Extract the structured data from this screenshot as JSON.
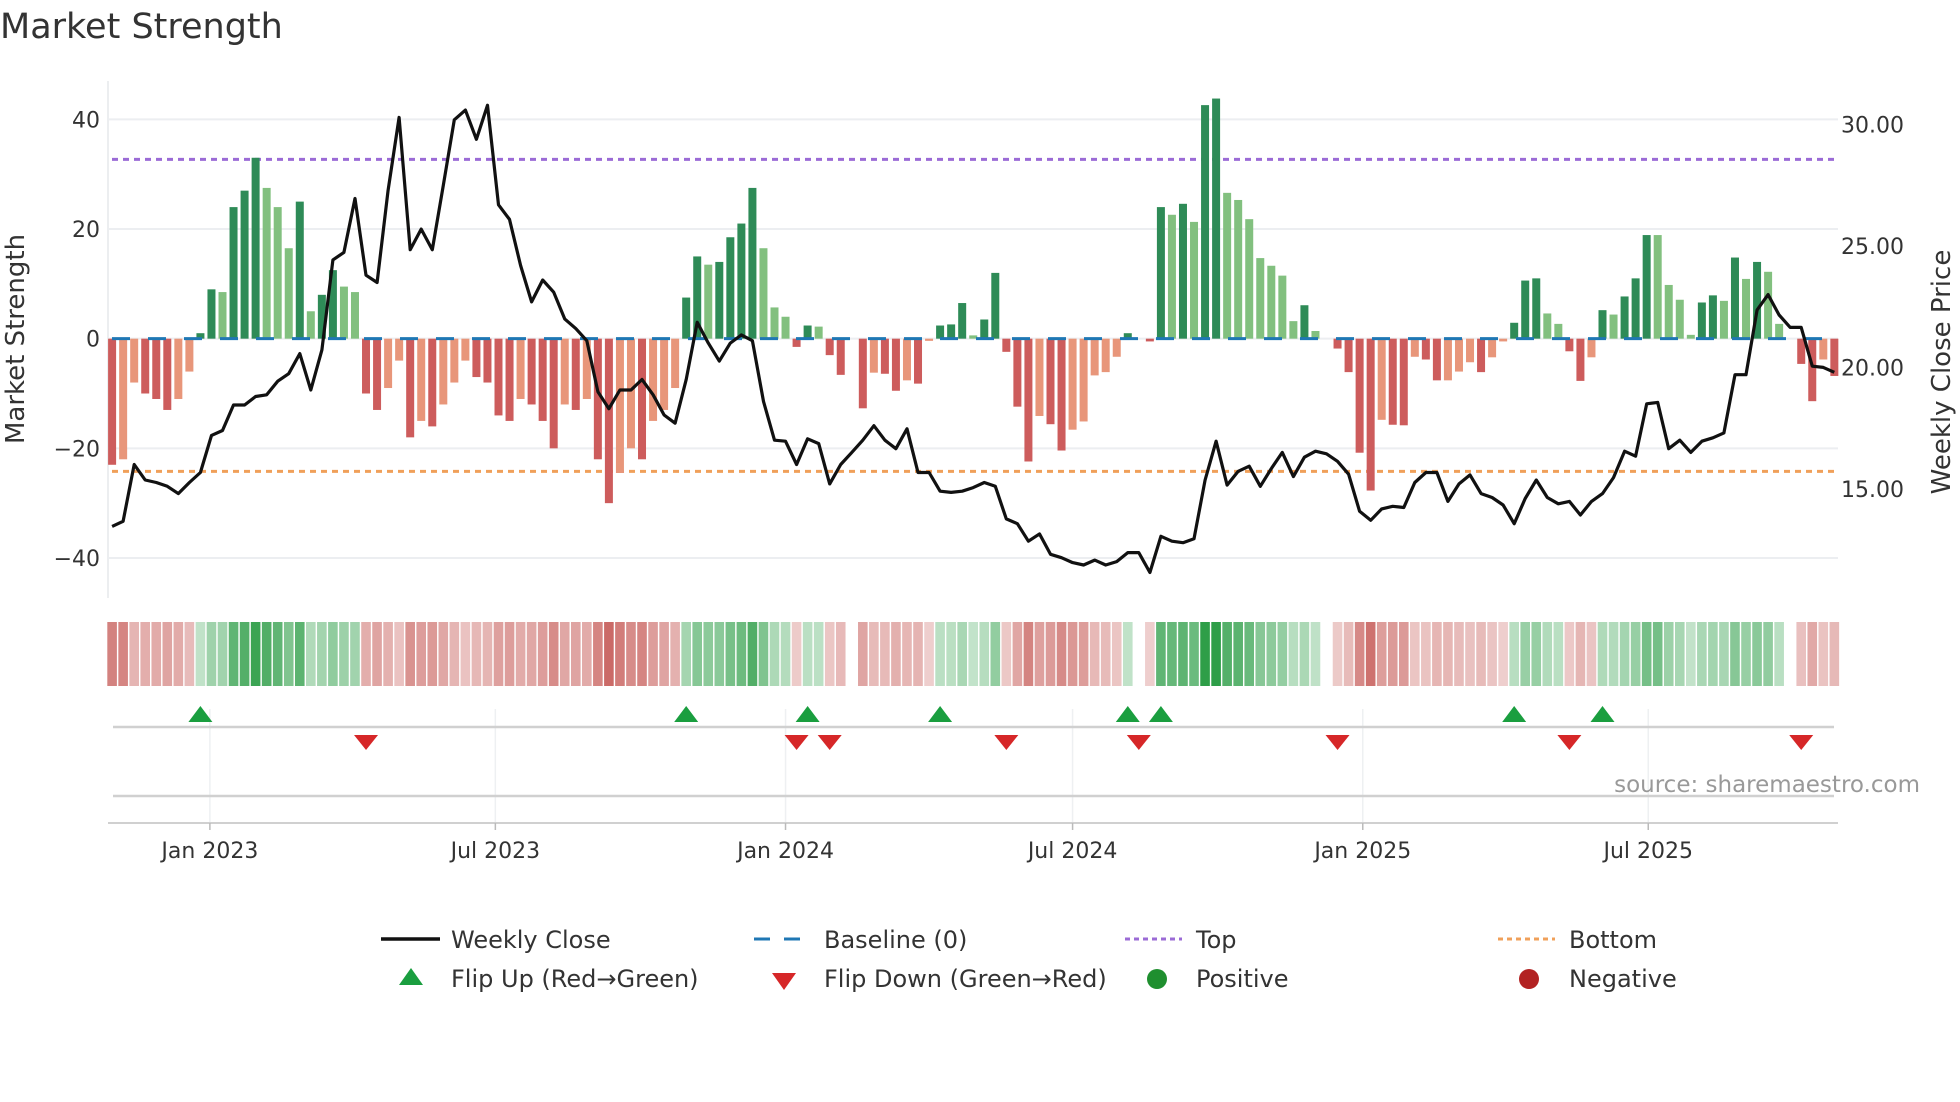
{
  "title": "Market Strength",
  "source": "source: sharemaestro.com",
  "legend": {
    "weekly_close": "Weekly Close",
    "baseline": "Baseline (0)",
    "top": "Top",
    "bottom": "Bottom",
    "flip_up": "Flip Up (Red→Green)",
    "flip_down": "Flip Down (Green→Red)",
    "positive": "Positive",
    "negative": "Negative"
  },
  "colors": {
    "green_dark": "#2e8b57",
    "green_light": "#82c07f",
    "red_dark": "#cd5c5c",
    "red_light": "#e8967a",
    "baseline": "#1f77b4",
    "top": "#9b6bd6",
    "bottom": "#f0a05a",
    "close": "#111111",
    "flip_up": "#1a9e3f",
    "flip_down": "#d62728",
    "positive": "#1f8f2f",
    "negative": "#b22222"
  },
  "chart_data": {
    "type": "bar",
    "title": "Market Strength",
    "ylabel": "Market Strength",
    "y2label": "Weekly Close Price",
    "ylim": [
      -47.3,
      47
    ],
    "y2lim": [
      10.5,
      31.8
    ],
    "yticks": [
      -40,
      -20,
      0,
      20,
      40
    ],
    "yticklabels": [
      "−40",
      "−20",
      "0",
      "20",
      "40"
    ],
    "y2ticks": [
      15,
      20,
      25,
      30
    ],
    "y2ticklabels": [
      "15.00",
      "20.00",
      "25.00",
      "30.00"
    ],
    "xticks": [
      "2023-01-01",
      "2023-07-01",
      "2024-01-01",
      "2024-07-01",
      "2025-01-01",
      "2025-07-01"
    ],
    "xticklabels": [
      "Jan 2023",
      "Jul 2023",
      "Jan 2024",
      "Jul 2024",
      "Jan 2025",
      "Jul 2025"
    ],
    "week_start": "2022-10-31",
    "week_step_days": 7,
    "top_level": 32.7,
    "bottom_level": -24.2,
    "baseline": 0,
    "strength": [
      -23,
      -22,
      -8,
      -10,
      -11,
      -13,
      -11,
      -6,
      1,
      9,
      8.5,
      24,
      27,
      33,
      27.5,
      24,
      16.5,
      25,
      5,
      8,
      12.5,
      9.5,
      8.5,
      -10,
      -13,
      -9,
      -4,
      -18,
      -15,
      -16,
      -12,
      -8,
      -4,
      -7,
      -8,
      -14,
      -15,
      -11,
      -12,
      -15,
      -20,
      -12,
      -13,
      -11,
      -22,
      -30,
      -24.5,
      -20,
      -22,
      -15,
      -13,
      -9,
      7.5,
      15,
      13.5,
      14,
      18.5,
      21,
      27.5,
      16.5,
      5.7,
      4,
      -1.5,
      2.4,
      2.2,
      -3,
      -6.6,
      0,
      -12.7,
      -6.2,
      -6.4,
      -9.5,
      -7.6,
      -8.2,
      -0.4,
      2.4,
      2.6,
      6.5,
      0.6,
      3.5,
      12,
      -2.4,
      -12.4,
      -22.4,
      -14.1,
      -15.6,
      -20.4,
      -16.6,
      -15.1,
      -6.7,
      -6.1,
      -3.3,
      1,
      0,
      -0.5,
      24,
      22.6,
      24.6,
      21.3,
      42.6,
      43.8,
      26.6,
      25.3,
      21.8,
      14.7,
      13.3,
      11.5,
      3.2,
      6.1,
      1.4,
      0,
      -1.8,
      -6.1,
      -20.8,
      -27.7,
      -14.8,
      -15.7,
      -15.8,
      -3.3,
      -3.8,
      -7.6,
      -7.6,
      -6,
      -4.3,
      -6.1,
      -3.4,
      -0.5,
      2.9,
      10.6,
      11,
      4.6,
      2.7,
      -2.3,
      -7.7,
      -3.4,
      5.2,
      4.4,
      7.7,
      11,
      18.9,
      18.9,
      9.8,
      7.1,
      0.7,
      6.6,
      7.9,
      6.9,
      14.8,
      10.9,
      14,
      12.2,
      2.7,
      0,
      -4.6,
      -11.4,
      -3.8,
      -6.8
    ],
    "close": [
      13.45,
      13.66,
      16.0,
      15.36,
      15.26,
      15.1,
      14.8,
      15.26,
      15.67,
      17.2,
      17.4,
      18.45,
      18.45,
      18.8,
      18.87,
      19.43,
      19.74,
      20.57,
      19.07,
      20.72,
      24.43,
      24.74,
      26.96,
      23.8,
      23.5,
      27.3,
      30.3,
      24.85,
      25.7,
      24.85,
      27.5,
      30.2,
      30.6,
      29.4,
      30.8,
      26.7,
      26.1,
      24.2,
      22.7,
      23.6,
      23.1,
      22.0,
      21.6,
      21.1,
      19.0,
      18.3,
      19.07,
      19.07,
      19.5,
      18.87,
      18.04,
      17.7,
      19.5,
      21.86,
      21.0,
      20.26,
      21.0,
      21.34,
      21.1,
      18.6,
      17.0,
      16.96,
      16.0,
      17.06,
      16.86,
      15.2,
      16.0,
      16.5,
      17.0,
      17.6,
      17.0,
      16.65,
      17.47,
      15.67,
      15.67,
      14.9,
      14.85,
      14.9,
      15.05,
      15.26,
      15.1,
      13.76,
      13.56,
      12.84,
      13.14,
      12.3,
      12.16,
      11.96,
      11.86,
      12.06,
      11.86,
      12.0,
      12.37,
      12.37,
      11.55,
      13.04,
      12.84,
      12.78,
      12.94,
      15.36,
      16.96,
      15.15,
      15.72,
      15.93,
      15.1,
      15.83,
      16.5,
      15.5,
      16.3,
      16.55,
      16.44,
      16.13,
      15.6,
      14.07,
      13.7,
      14.17,
      14.28,
      14.23,
      15.26,
      15.67,
      15.67,
      14.48,
      15.2,
      15.57,
      14.8,
      14.64,
      14.33,
      13.56,
      14.6,
      15.36,
      14.64,
      14.38,
      14.48,
      13.92,
      14.48,
      14.8,
      15.46,
      16.55,
      16.34,
      18.5,
      18.56,
      16.65,
      17.0,
      16.5,
      16.96,
      17.1,
      17.3,
      19.7,
      19.7,
      22.37,
      23.0,
      22.16,
      21.65,
      21.65,
      20.05,
      20.0,
      19.8
    ],
    "flip_up_dates": [
      "2022-12-26",
      "2023-10-30",
      "2024-01-15",
      "2024-04-08",
      "2024-08-05",
      "2024-08-26",
      "2025-04-07",
      "2025-06-02"
    ],
    "flip_down_dates": [
      "2023-04-10",
      "2024-01-08",
      "2024-01-29",
      "2024-05-20",
      "2024-08-12",
      "2024-12-16",
      "2025-05-12",
      "2025-10-06"
    ],
    "grid": true,
    "legend_placement": "bottom-center"
  }
}
